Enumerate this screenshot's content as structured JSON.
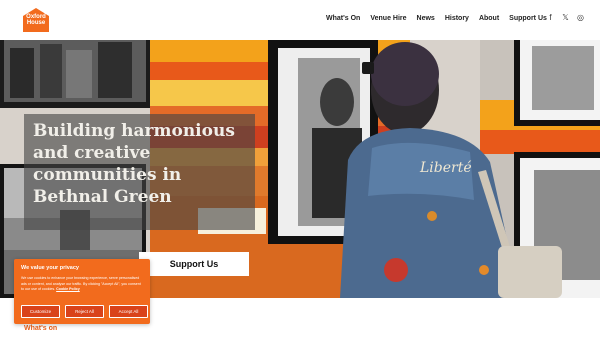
{
  "header": {
    "logo_text_line1": "Oxford",
    "logo_text_line2": "House",
    "nav": [
      {
        "label": "What's On"
      },
      {
        "label": "Venue Hire"
      },
      {
        "label": "News"
      },
      {
        "label": "History"
      },
      {
        "label": "About"
      },
      {
        "label": "Support Us"
      }
    ],
    "social": [
      {
        "icon": "facebook-icon",
        "glyph": "f"
      },
      {
        "icon": "twitter-icon",
        "glyph": "𝕏"
      },
      {
        "icon": "instagram-icon",
        "glyph": "◎"
      }
    ]
  },
  "hero": {
    "headline": "Building harmonious and creative communities in Bethnal Green",
    "support_button": "Support Us",
    "jacket_text": "Liberté"
  },
  "cookie": {
    "title": "We value your privacy",
    "text": "We use cookies to enhance your browsing experience, serve personalised ads or content, and analyse our traffic. By clicking \"Accept All\", you consent to our use of cookies.",
    "policy_link": "Cookie Policy",
    "customize": "Customize",
    "reject": "Reject All",
    "accept": "Accept All"
  },
  "section": {
    "whats_on": "What's on"
  },
  "colors": {
    "brand_orange": "#f26b1d",
    "heading_orange": "#e8601c"
  }
}
